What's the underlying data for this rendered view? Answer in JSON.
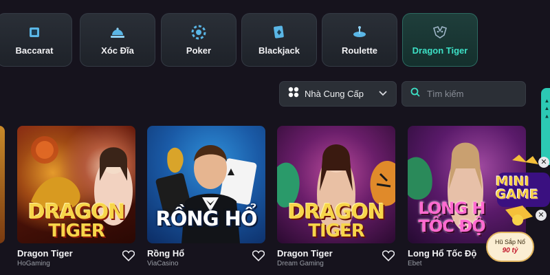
{
  "tabs": [
    {
      "label": "Baccarat",
      "icon": "baccarat-cards-icon",
      "active": false
    },
    {
      "label": "Xóc Đĩa",
      "icon": "bell-cloche-icon",
      "active": false
    },
    {
      "label": "Poker",
      "icon": "poker-chip-icon",
      "active": false
    },
    {
      "label": "Blackjack",
      "icon": "blackjack-card-icon",
      "active": false
    },
    {
      "label": "Roulette",
      "icon": "roulette-icon",
      "active": false
    },
    {
      "label": "Dragon Tiger",
      "icon": "dragon-tiger-icon",
      "active": true
    }
  ],
  "filters": {
    "provider_label": "Nhà Cung Cấp",
    "search_placeholder": "Tìm kiếm"
  },
  "games": [
    {
      "name": "Dragon Tiger",
      "provider": "HoGaming",
      "logo_line1": "DRAGON",
      "logo_line2": "TIGER"
    },
    {
      "name": "Rồng Hổ",
      "provider": "ViaCasino",
      "logo_line1": "RỒNG HỔ"
    },
    {
      "name": "Dragon Tiger",
      "provider": "Dream Gaming",
      "logo_line1": "DRAGON",
      "logo_line2": "TIGER"
    },
    {
      "name": "Long Hổ Tốc Độ",
      "provider": "Ebet",
      "logo_line1": "LONG H",
      "logo_line2": "TỐC ĐỘ"
    }
  ],
  "promo": {
    "title": "MINI GAME",
    "line1": "Hũ Sắp Nổ",
    "line2": "90 tỷ"
  },
  "colors": {
    "accent": "#3de1c6",
    "background": "#16131d",
    "panel": "#2b2f36"
  }
}
